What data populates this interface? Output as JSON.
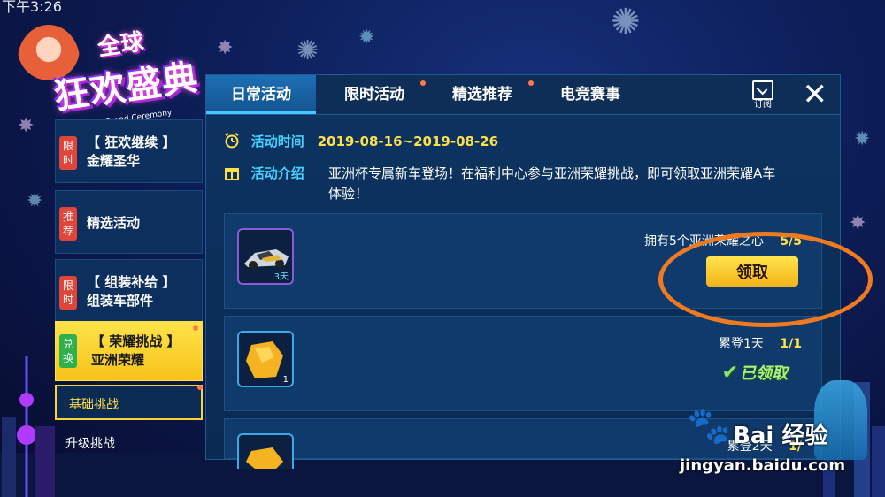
{
  "status_bar": {
    "time": "下午3:26"
  },
  "logo": {
    "top": "全球",
    "main": "狂欢盛典",
    "sub": "Grand Ceremony"
  },
  "sidebar": {
    "items": [
      {
        "badge": "限时",
        "label": "【 狂欢继续 】\n金耀圣华"
      },
      {
        "badge": "推荐",
        "label": "精选活动"
      },
      {
        "badge": "限时",
        "label": "【 组装补给 】\n组装车部件"
      },
      {
        "badge": "兑换",
        "label": "【 荣耀挑战 】\n亚洲荣耀"
      }
    ],
    "sub_items": [
      "基础挑战",
      "升级挑战"
    ]
  },
  "tabs": [
    "日常活动",
    "限时活动",
    "精选推荐",
    "电竞赛事"
  ],
  "subscribe_label": "订阅",
  "close_label": "✕",
  "activity": {
    "time_label": "活动时间",
    "time_value": "2019-08-16~2019-08-26",
    "intro_label": "活动介绍",
    "intro_value": "亚洲杯专属新车登场！在福利中心参与亚洲荣耀挑战，即可领取亚洲荣耀A车体验！"
  },
  "tasks": [
    {
      "requirement": "拥有5个亚洲荣耀之心",
      "count": "5/5",
      "item_qty": "3天",
      "action": "领取"
    },
    {
      "requirement": "累登1天",
      "count": "1/1",
      "item_qty": "1",
      "action": "已领取"
    },
    {
      "requirement": "累登2天",
      "count": "1/",
      "item_qty": ""
    }
  ],
  "watermark": {
    "brand": "Bai 经验",
    "url": "jingyan.baidu.com"
  },
  "colors": {
    "accent": "#45d1ff",
    "highlight": "#ffe04a",
    "annotation": "#f07a1f"
  }
}
